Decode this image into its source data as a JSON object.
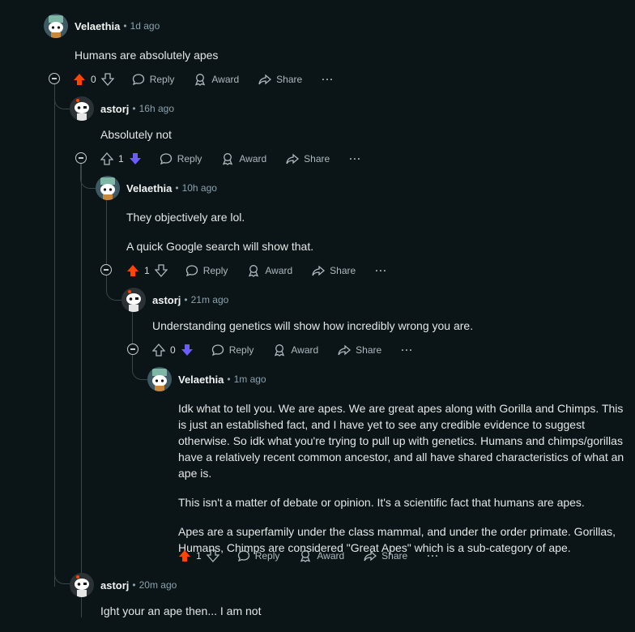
{
  "comments": [
    {
      "author": "Velaethia",
      "time": "1d ago",
      "body": [
        "Humans are absolutely apes"
      ],
      "votes": "0",
      "vote_state": "up"
    },
    {
      "author": "astorj",
      "time": "16h ago",
      "body": [
        "Absolutely not"
      ],
      "votes": "1",
      "vote_state": "down"
    },
    {
      "author": "Velaethia",
      "time": "10h ago",
      "body": [
        "They objectively are lol.",
        "A quick Google search will show that."
      ],
      "votes": "1",
      "vote_state": "up"
    },
    {
      "author": "astorj",
      "time": "21m ago",
      "body": [
        "Understanding genetics will show how incredibly wrong you are."
      ],
      "votes": "0",
      "vote_state": "down"
    },
    {
      "author": "Velaethia",
      "time": "1m ago",
      "body": [
        "Idk what to tell you. We are apes. We are great apes along with Gorilla and Chimps. This is just an established fact, and I have yet to see any credible evidence to suggest otherwise. So idk what you're trying to pull up with genetics. Humans and chimps/gorillas have a relatively recent common ancestor, and all have shared characteristics of what an ape is.",
        "This isn't a matter of debate or opinion. It's a scientific fact that humans are apes.",
        "Apes are a superfamily under the class mammal, and under the order primate. Gorillas, Humans, Chimps are considered \"Great Apes\" which is a sub-category of ape."
      ],
      "votes": "1",
      "vote_state": "up"
    },
    {
      "author": "astorj",
      "time": "20m ago",
      "body": [
        "Ight your an ape then... I am not"
      ]
    }
  ],
  "labels": {
    "dot": "•",
    "reply": "Reply",
    "award": "Award",
    "share": "Share",
    "more": "···"
  },
  "colors": {
    "upvote": "#ff4500",
    "downvote": "#6a5cff",
    "background": "#0b1416"
  },
  "icons": {
    "up": "upvote-arrow-icon",
    "down": "downvote-arrow-icon",
    "reply": "speech-bubble-icon",
    "award": "award-icon",
    "share": "share-arrow-icon"
  }
}
